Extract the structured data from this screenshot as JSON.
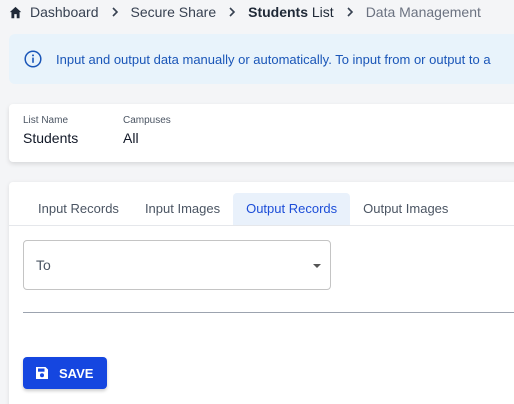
{
  "breadcrumb": {
    "items": [
      {
        "label": "Dashboard",
        "icon": "home-icon"
      },
      {
        "label": "Secure Share"
      },
      {
        "label": "Students List",
        "bold_part": "Students",
        "rest": " List"
      },
      {
        "label": "Data Management"
      }
    ],
    "separator_icon": "chevron-right-icon"
  },
  "banner": {
    "icon": "info-icon",
    "text": "Input and output data manually or automatically. To input from or output to a"
  },
  "list_info": {
    "list_name_label": "List Name",
    "list_name_value": "Students",
    "campuses_label": "Campuses",
    "campuses_value": "All"
  },
  "data_management": {
    "tabs": [
      {
        "label": "Input Records",
        "active": false
      },
      {
        "label": "Input Images",
        "active": false
      },
      {
        "label": "Output Records",
        "active": true
      },
      {
        "label": "Output Images",
        "active": false
      }
    ],
    "to_select": {
      "label": "To",
      "icon": "caret-down-icon"
    },
    "save_button": {
      "label": "SAVE",
      "icon": "save-icon"
    }
  },
  "colors": {
    "accent": "#1546e0",
    "banner_bg": "#e8f3fb",
    "banner_text": "#1a56b8",
    "active_tab_bg": "#e9f1fb",
    "active_tab_text": "#1d4ed8"
  }
}
